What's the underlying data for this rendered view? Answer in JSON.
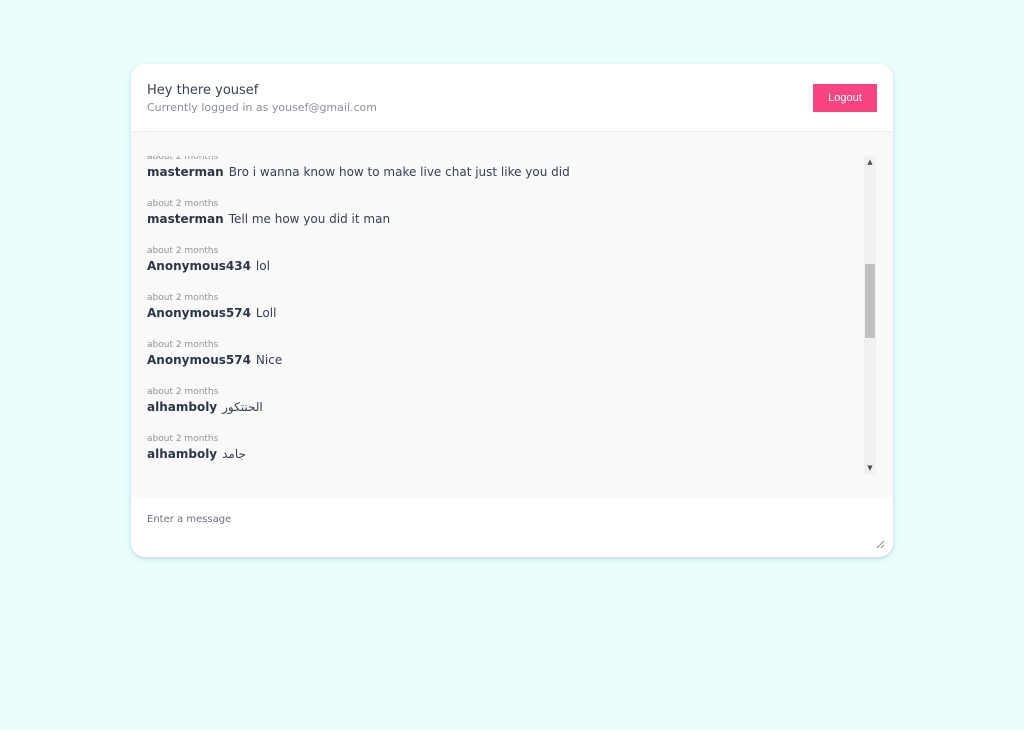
{
  "header": {
    "greeting": "Hey there yousef",
    "logged_in_text": "Currently logged in as yousef@gmail.com",
    "logout_label": "Logout"
  },
  "messages": [
    {
      "time": "about 2 months",
      "user": "masterman",
      "text": "Bro i wanna know how to make live chat just like you did"
    },
    {
      "time": "about 2 months",
      "user": "masterman",
      "text": "Tell me how you did it man"
    },
    {
      "time": "about 2 months",
      "user": "Anonymous434",
      "text": "lol"
    },
    {
      "time": "about 2 months",
      "user": "Anonymous574",
      "text": "Loll"
    },
    {
      "time": "about 2 months",
      "user": "Anonymous574",
      "text": "Nice"
    },
    {
      "time": "about 2 months",
      "user": "alhamboly",
      "text": "الحنتكور"
    },
    {
      "time": "about 2 months",
      "user": "alhamboly",
      "text": "جامد"
    }
  ],
  "composer": {
    "placeholder": "Enter a message"
  },
  "icons": {
    "scroll_up": "scroll-up-arrow-icon",
    "scroll_down": "scroll-down-arrow-icon",
    "resize": "resize-grip-icon"
  },
  "colors": {
    "page_background": "#e9fefd",
    "logout_button": "#f8457f",
    "message_area_background": "#f9f9f9"
  }
}
